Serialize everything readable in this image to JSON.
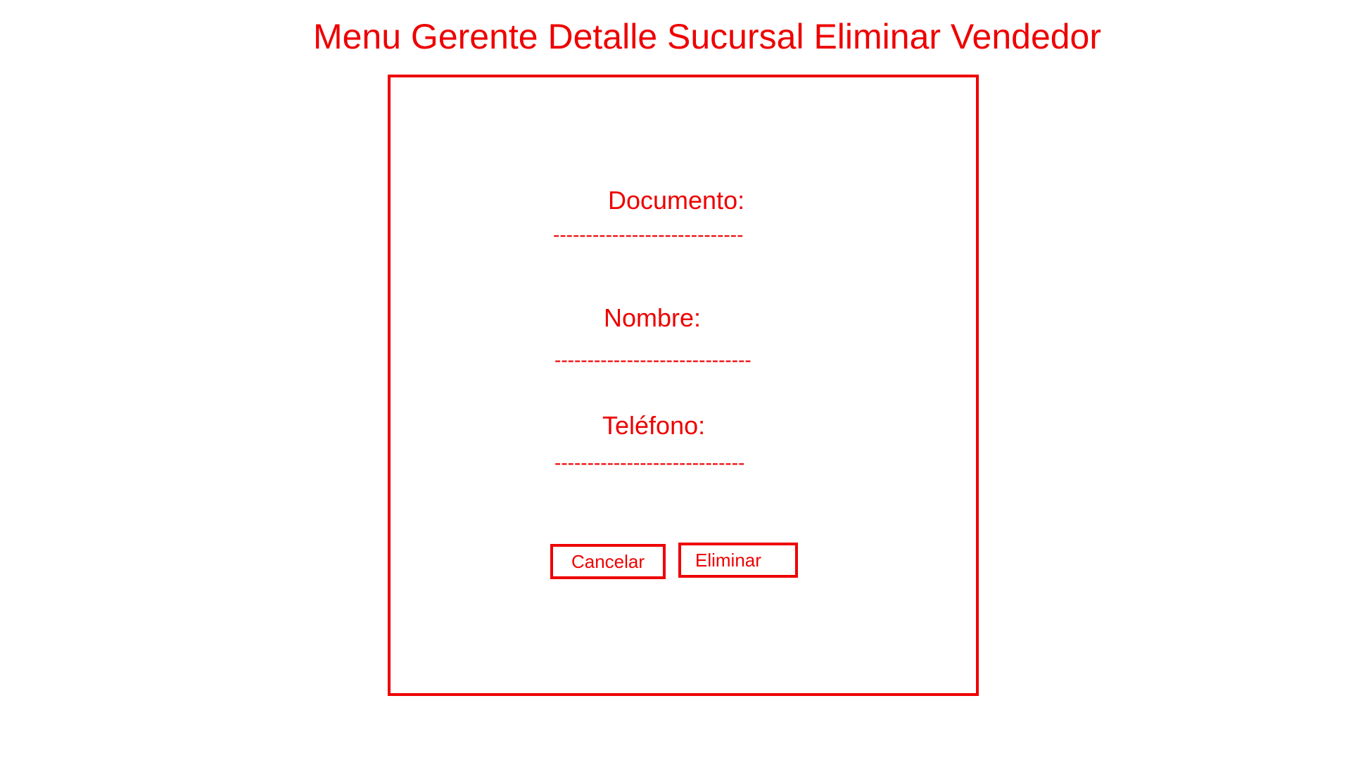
{
  "header": {
    "title": "Menu Gerente Detalle Sucursal Eliminar Vendedor"
  },
  "form": {
    "documento_label": "Documento:",
    "documento_value": "-----------------------------",
    "nombre_label": "Nombre:",
    "nombre_value": "------------------------------",
    "telefono_label": "Teléfono:",
    "telefono_value": "-----------------------------"
  },
  "actions": {
    "cancel_label": "Cancelar",
    "delete_label": "Eliminar"
  },
  "colors": {
    "accent": "#ee0000",
    "background": "#ffffff"
  }
}
